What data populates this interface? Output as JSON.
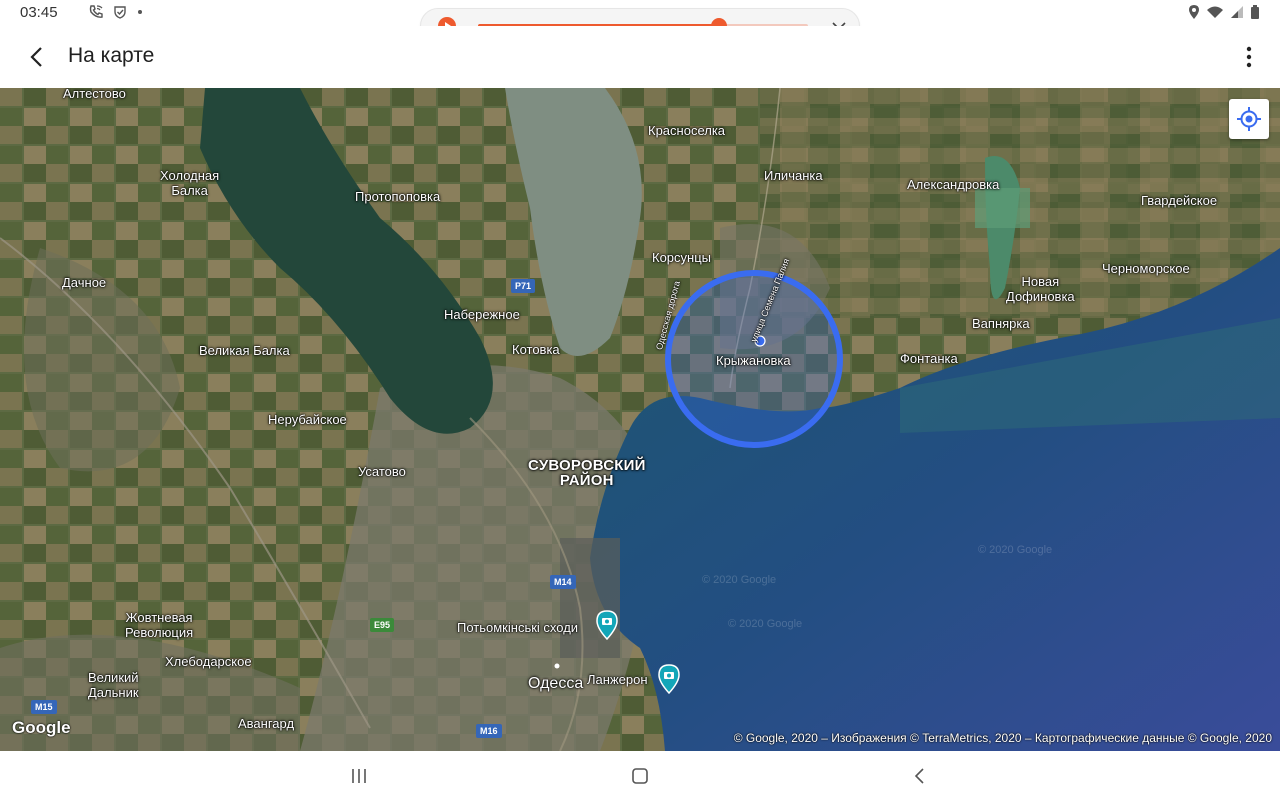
{
  "status_bar": {
    "time": "03:45",
    "left_icons": [
      "phone-wifi-icon",
      "shield-check-icon",
      "dot-icon"
    ],
    "right_icons": [
      "location-icon",
      "wifi-icon",
      "signal-icon",
      "battery-icon"
    ]
  },
  "media_player": {
    "progress": 0.73,
    "accent_color": "#ee5a2e",
    "icons": [
      "play-icon",
      "chevron-down-icon"
    ]
  },
  "app_bar": {
    "title": "На карте",
    "icons": [
      "back-arrow-icon",
      "more-vert-icon"
    ]
  },
  "map": {
    "labels": {
      "altestovo": "Алтестово",
      "kholodnaya_balka_1": "Холодная",
      "kholodnaya_balka_2": "Балка",
      "protopopovka": "Протопоповка",
      "krasnoselka": "Красноселка",
      "ilichanka": "Иличанка",
      "aleksandrovka": "Александровка",
      "gvardeyskoe": "Гвардейское",
      "dachnoe": "Дачное",
      "korsuntsy": "Корсунцы",
      "novaya_dofinovka_1": "Новая",
      "novaya_dofinovka_2": "Дофиновка",
      "chernomorskoe": "Черноморское",
      "naberezhnoe": "Набережное",
      "vapnyarka": "Вапнярка",
      "velikaya_balka": "Великая Балка",
      "kotovka": "Котовка",
      "kryzhanovka": "Крыжановка",
      "fontanka": "Фонтанка",
      "nerubayskoe": "Нерубайское",
      "usatovo": "Усатово",
      "suvorovsky_1": "СУВОРОВСКИЙ",
      "suvorovsky_2": "РАЙОН",
      "zhovtnevaya_1": "Жовтневая",
      "zhovtnevaya_2": "Революция",
      "potyomkin": "Потьомкінські сходи",
      "khlebodarskoe": "Хлебодарское",
      "veliky_dalnik_1": "Великий",
      "veliky_dalnik_2": "Дальник",
      "odessa": "Одесса",
      "lanzheron": "Ланжерон",
      "avangard": "Авангард",
      "street_1": "Одесская дорога",
      "street_2": "улица Семена Палия"
    },
    "road_shields": {
      "p71": "P71",
      "m14": "M14",
      "e95": "E95",
      "m15": "M15",
      "m16": "M16"
    },
    "watermark": "© 2020 Google",
    "logo": "Google",
    "attribution": "© Google, 2020 – Изображения © TerraMetrics, 2020 – Картографические данные © Google, 2020",
    "icons": [
      "my-location-icon",
      "camera-pin-icon"
    ],
    "circle_color": "#3a6cf0"
  },
  "nav_bar": {
    "icons": [
      "recent-apps-icon",
      "home-icon",
      "back-icon"
    ]
  }
}
